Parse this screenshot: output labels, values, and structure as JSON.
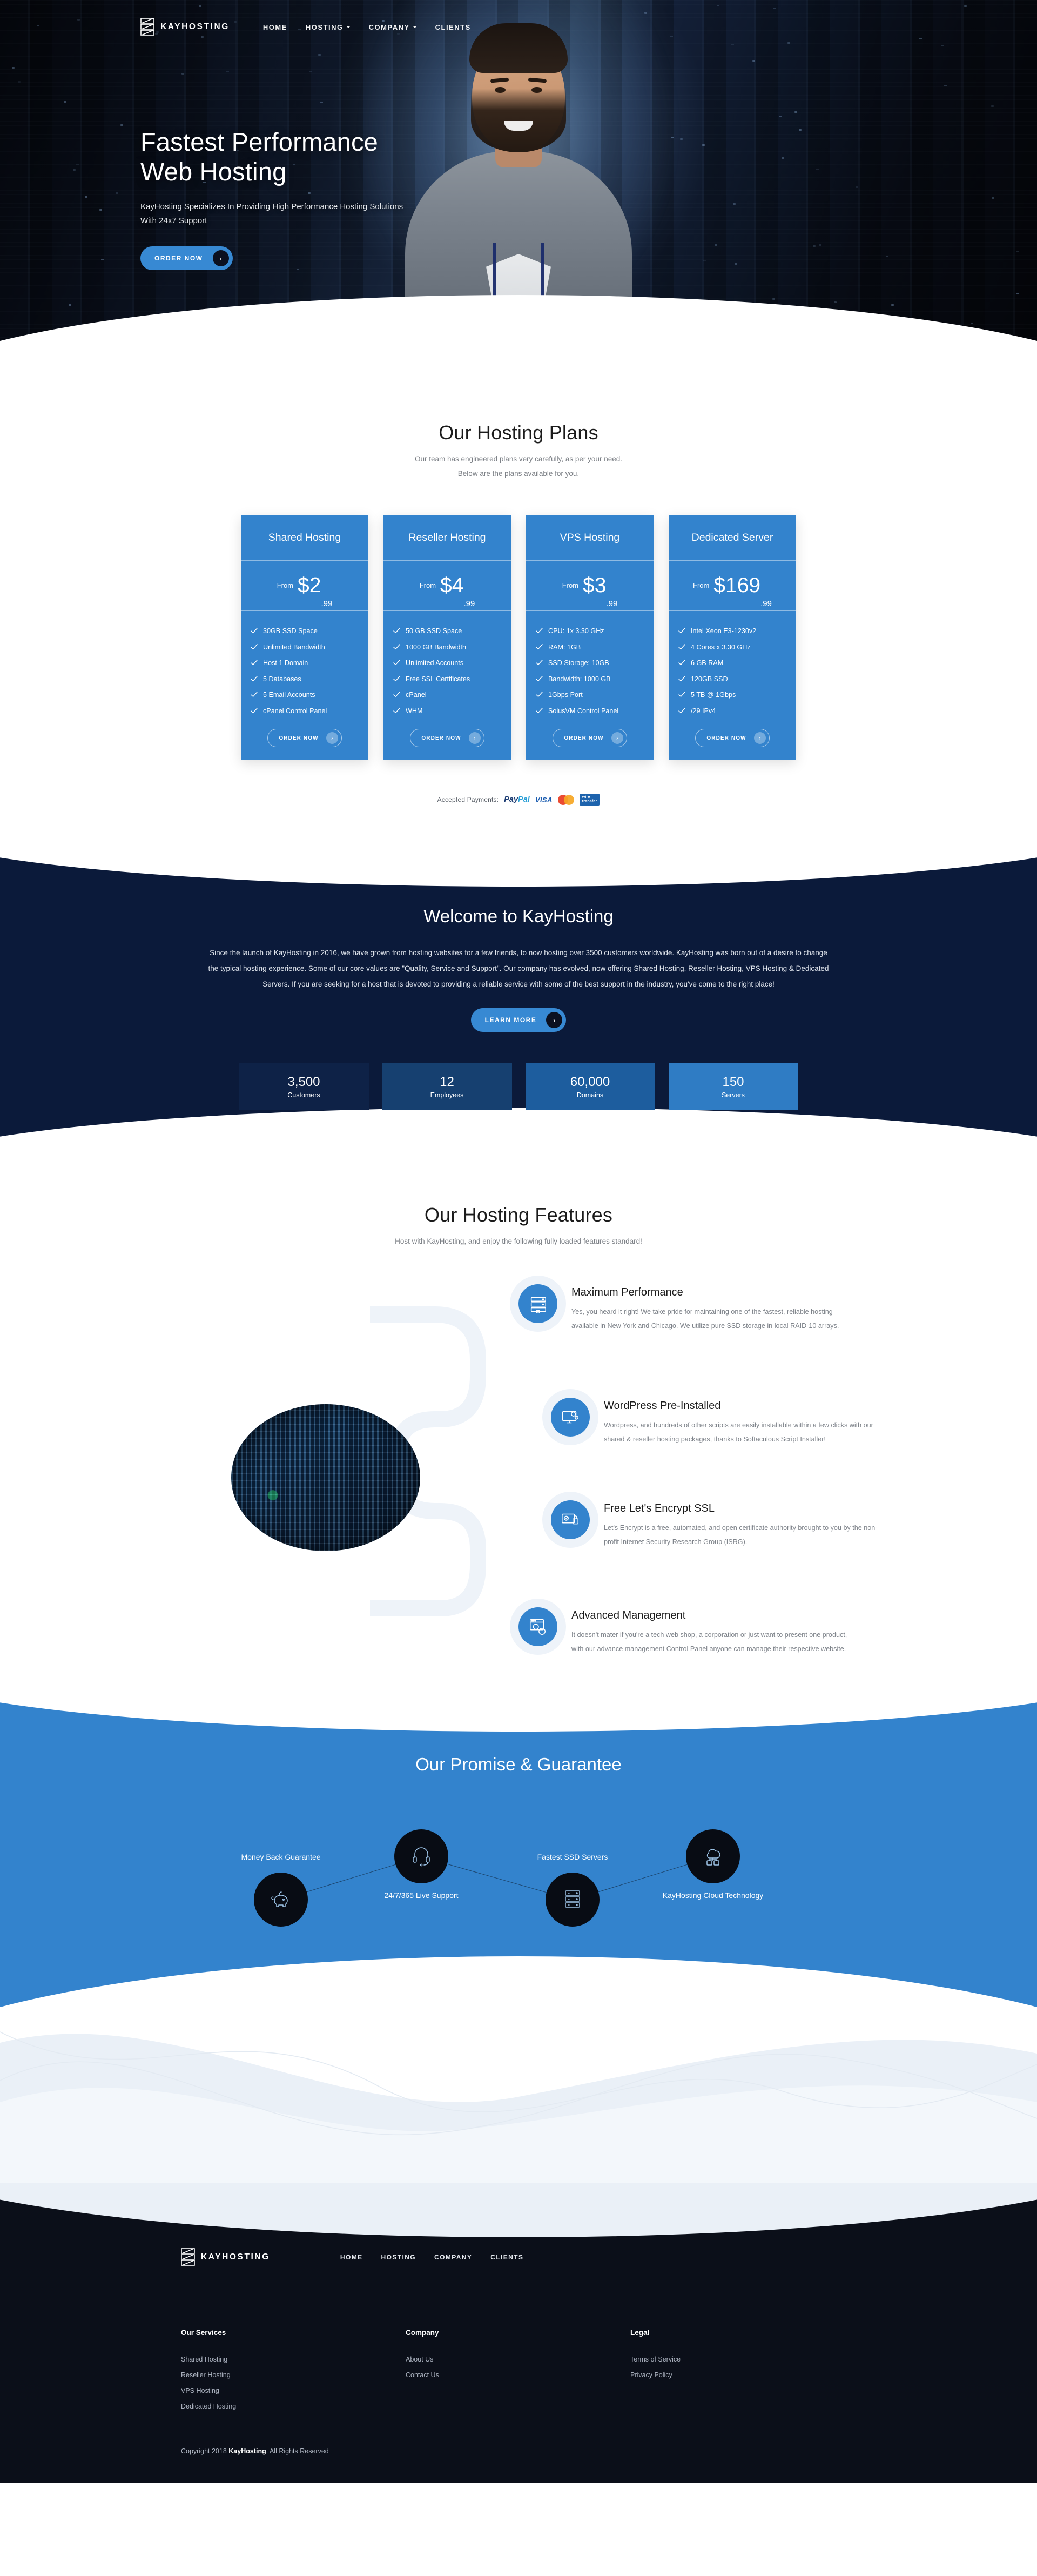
{
  "brand": {
    "name": "KAYHOSTING",
    "logo_icon": "kayhosting-logo-icon"
  },
  "nav": {
    "items": [
      {
        "label": "HOME",
        "has_caret": false
      },
      {
        "label": "HOSTING",
        "has_caret": true
      },
      {
        "label": "COMPANY",
        "has_caret": true
      },
      {
        "label": "CLIENTS",
        "has_caret": false
      }
    ]
  },
  "hero": {
    "title_line1": "Fastest Performance",
    "title_line2": "Web Hosting",
    "subtitle": "KayHosting Specializes In Providing High Performance Hosting Solutions With 24x7 Support",
    "cta_label": "ORDER NOW",
    "cta_arrow": "›"
  },
  "plans_section": {
    "title": "Our Hosting Plans",
    "subtitle_line1": "Our team has engineered plans very carefully, as per your need.",
    "subtitle_line2": "Below are the plans available for you.",
    "from_label": "From",
    "cta_label": "ORDER NOW",
    "cta_arrow": "›",
    "plans": [
      {
        "name": "Shared Hosting",
        "price_main": "$2",
        "price_cents": ".99",
        "features": [
          "30GB SSD Space",
          "Unlimited Bandwidth",
          "Host 1 Domain",
          "5 Databases",
          "5 Email Accounts",
          "cPanel Control Panel"
        ]
      },
      {
        "name": "Reseller Hosting",
        "price_main": "$4",
        "price_cents": ".99",
        "features": [
          "50 GB SSD Space",
          "1000 GB Bandwidth",
          "Unlimited Accounts",
          "Free SSL Certificates",
          "cPanel",
          "WHM"
        ]
      },
      {
        "name": "VPS Hosting",
        "price_main": "$3",
        "price_cents": ".99",
        "features": [
          "CPU: 1x 3.30 GHz",
          "RAM: 1GB",
          "SSD Storage: 10GB",
          "Bandwidth: 1000 GB",
          "1Gbps Port",
          "SolusVM Control Panel"
        ]
      },
      {
        "name": "Dedicated Server",
        "price_main": "$169",
        "price_cents": ".99",
        "features": [
          "Intel Xeon E3-1230v2",
          "4 Cores x 3.30 GHz",
          "6 GB RAM",
          "120GB SSD",
          "5 TB @ 1Gbps",
          "/29 IPv4"
        ]
      }
    ]
  },
  "payments": {
    "label": "Accepted Payments:",
    "methods": [
      "PayPal",
      "VISA",
      "Mastercard",
      "wire transfer"
    ],
    "paypal_a": "Pay",
    "paypal_b": "Pal",
    "visa": "VISA",
    "wire_line1": "wire",
    "wire_line2": "transfer"
  },
  "welcome": {
    "title": "Welcome to KayHosting",
    "body": "Since the launch of KayHosting in 2016, we have grown from hosting websites for a few friends, to now hosting over 3500 customers worldwide. KayHosting was born out of a desire to change the typical hosting experience. Some of our core values are \"Quality, Service and Support\". Our company has evolved, now offering Shared Hosting, Reseller Hosting, VPS Hosting & Dedicated Servers. If you are seeking for a host that is devoted to providing a reliable service with some of the best support in the industry, you've come to the right place!",
    "cta_label": "LEARN MORE",
    "cta_arrow": "›",
    "stats": [
      {
        "number": "3,500",
        "label": "Customers",
        "color": "#0e2247"
      },
      {
        "number": "12",
        "label": "Employees",
        "color": "#164070"
      },
      {
        "number": "60,000",
        "label": "Domains",
        "color": "#1d5d9e"
      },
      {
        "number": "150",
        "label": "Servers",
        "color": "#2f7cc4"
      }
    ]
  },
  "features_section": {
    "title": "Our Hosting Features",
    "subtitle": "Host with KayHosting, and enjoy the following fully loaded features standard!",
    "items": [
      {
        "icon": "server-rack-icon",
        "title": "Maximum Performance",
        "body": "Yes, you heard it right! We take pride for maintaining one of the fastest, reliable hosting available in New York and Chicago. We utilize pure SSD storage in local RAID-10 arrays."
      },
      {
        "icon": "monitor-gear-icon",
        "title": "WordPress Pre-Installed",
        "body": "Wordpress, and hundreds of other scripts are easily installable within a few clicks with our shared & reseller hosting packages, thanks to Softaculous Script Installer!"
      },
      {
        "icon": "monitor-lock-icon",
        "title": "Free Let's Encrypt SSL",
        "body": "Let's Encrypt is a free, automated, and open certificate authority brought to you by the non-profit Internet Security Research Group (ISRG)."
      },
      {
        "icon": "browser-gears-icon",
        "title": "Advanced Management",
        "body": "It doesn't mater if you're a tech web shop, a corporation or just want to present one product, with our advance management Control Panel anyone can manage their respective website."
      }
    ]
  },
  "promise_section": {
    "title": "Our Promise & Guarantee",
    "nodes": [
      {
        "icon": "piggy-bank-icon",
        "caption": "Money Back Guarantee"
      },
      {
        "icon": "headset-icon",
        "caption": "24/7/365 Live Support"
      },
      {
        "icon": "server-stack-icon",
        "caption": "Fastest SSD Servers"
      },
      {
        "icon": "cloud-server-icon",
        "caption": "KayHosting Cloud Technology"
      }
    ]
  },
  "footer": {
    "brand": "KAYHOSTING",
    "nav": [
      "HOME",
      "HOSTING",
      "COMPANY",
      "CLIENTS"
    ],
    "columns": [
      {
        "heading": "Our Services",
        "links": [
          "Shared Hosting",
          "Reseller Hosting",
          "VPS Hosting",
          "Dedicated Hosting"
        ]
      },
      {
        "heading": "Company",
        "links": [
          "About Us",
          "Contact Us"
        ]
      },
      {
        "heading": "Legal",
        "links": [
          "Terms of Service",
          "Privacy Policy"
        ]
      }
    ],
    "copyright_pre": "Copyright 2018 ",
    "copyright_brand": "KayHosting",
    "copyright_post": ". All Rights Reserved"
  },
  "colors": {
    "accent": "#3383cd",
    "dark": "#0b1a3a",
    "footer": "#0b0f19",
    "wave": "#eaf0f7"
  }
}
